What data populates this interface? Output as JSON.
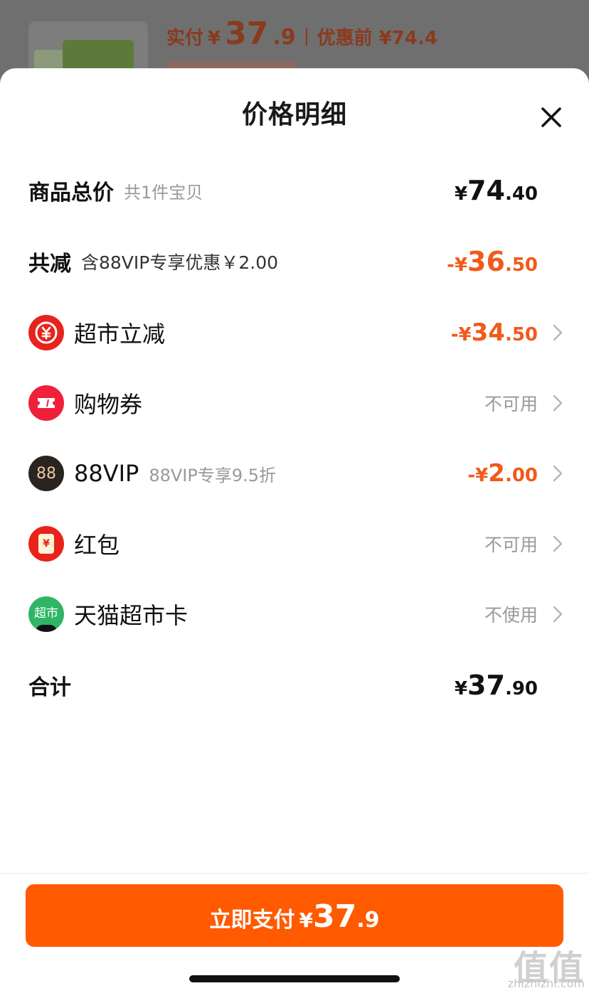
{
  "background": {
    "actual_pay_label": "实付",
    "actual_pay_currency": "¥",
    "actual_pay_int": "37",
    "actual_pay_dec": ".9",
    "before_discount": "优惠前 ¥74.4"
  },
  "sheet": {
    "title": "价格明细"
  },
  "total_price": {
    "label": "商品总价",
    "sub": "共1件宝贝",
    "currency": "¥",
    "int": "74",
    "dec": ".40"
  },
  "total_reduction": {
    "label": "共减",
    "sub": "含88VIP专享优惠￥2.00",
    "currency": "-¥",
    "int": "36",
    "dec": ".50"
  },
  "items": [
    {
      "icon": "yuan-down-icon",
      "label": "超市立减",
      "sub": "",
      "currency": "-¥",
      "int": "34",
      "dec": ".50",
      "status": ""
    },
    {
      "icon": "ticket-icon",
      "label": "购物券",
      "sub": "",
      "status": "不可用"
    },
    {
      "icon": "vip88-icon",
      "icon_text": "88",
      "label": "88VIP",
      "sub": "88VIP专享9.5折",
      "currency": "-¥",
      "int": "2",
      "dec": ".00",
      "status": ""
    },
    {
      "icon": "red-envelope-icon",
      "icon_text": "¥",
      "label": "红包",
      "sub": "",
      "status": "不可用"
    },
    {
      "icon": "tmall-supermarket-card-icon",
      "icon_text": "超市",
      "label": "天猫超市卡",
      "sub": "",
      "status": "不使用"
    }
  ],
  "sum": {
    "label": "合计",
    "currency": "¥",
    "int": "37",
    "dec": ".90"
  },
  "pay_button": {
    "label": "立即支付",
    "currency": "¥",
    "int": "37",
    "dec": ".9"
  },
  "watermark": {
    "text": "值值值",
    "url": "zhizhizhi.com"
  },
  "colors": {
    "accent": "#ff5a00",
    "discount": "#f05a1a",
    "muted": "#999999"
  }
}
